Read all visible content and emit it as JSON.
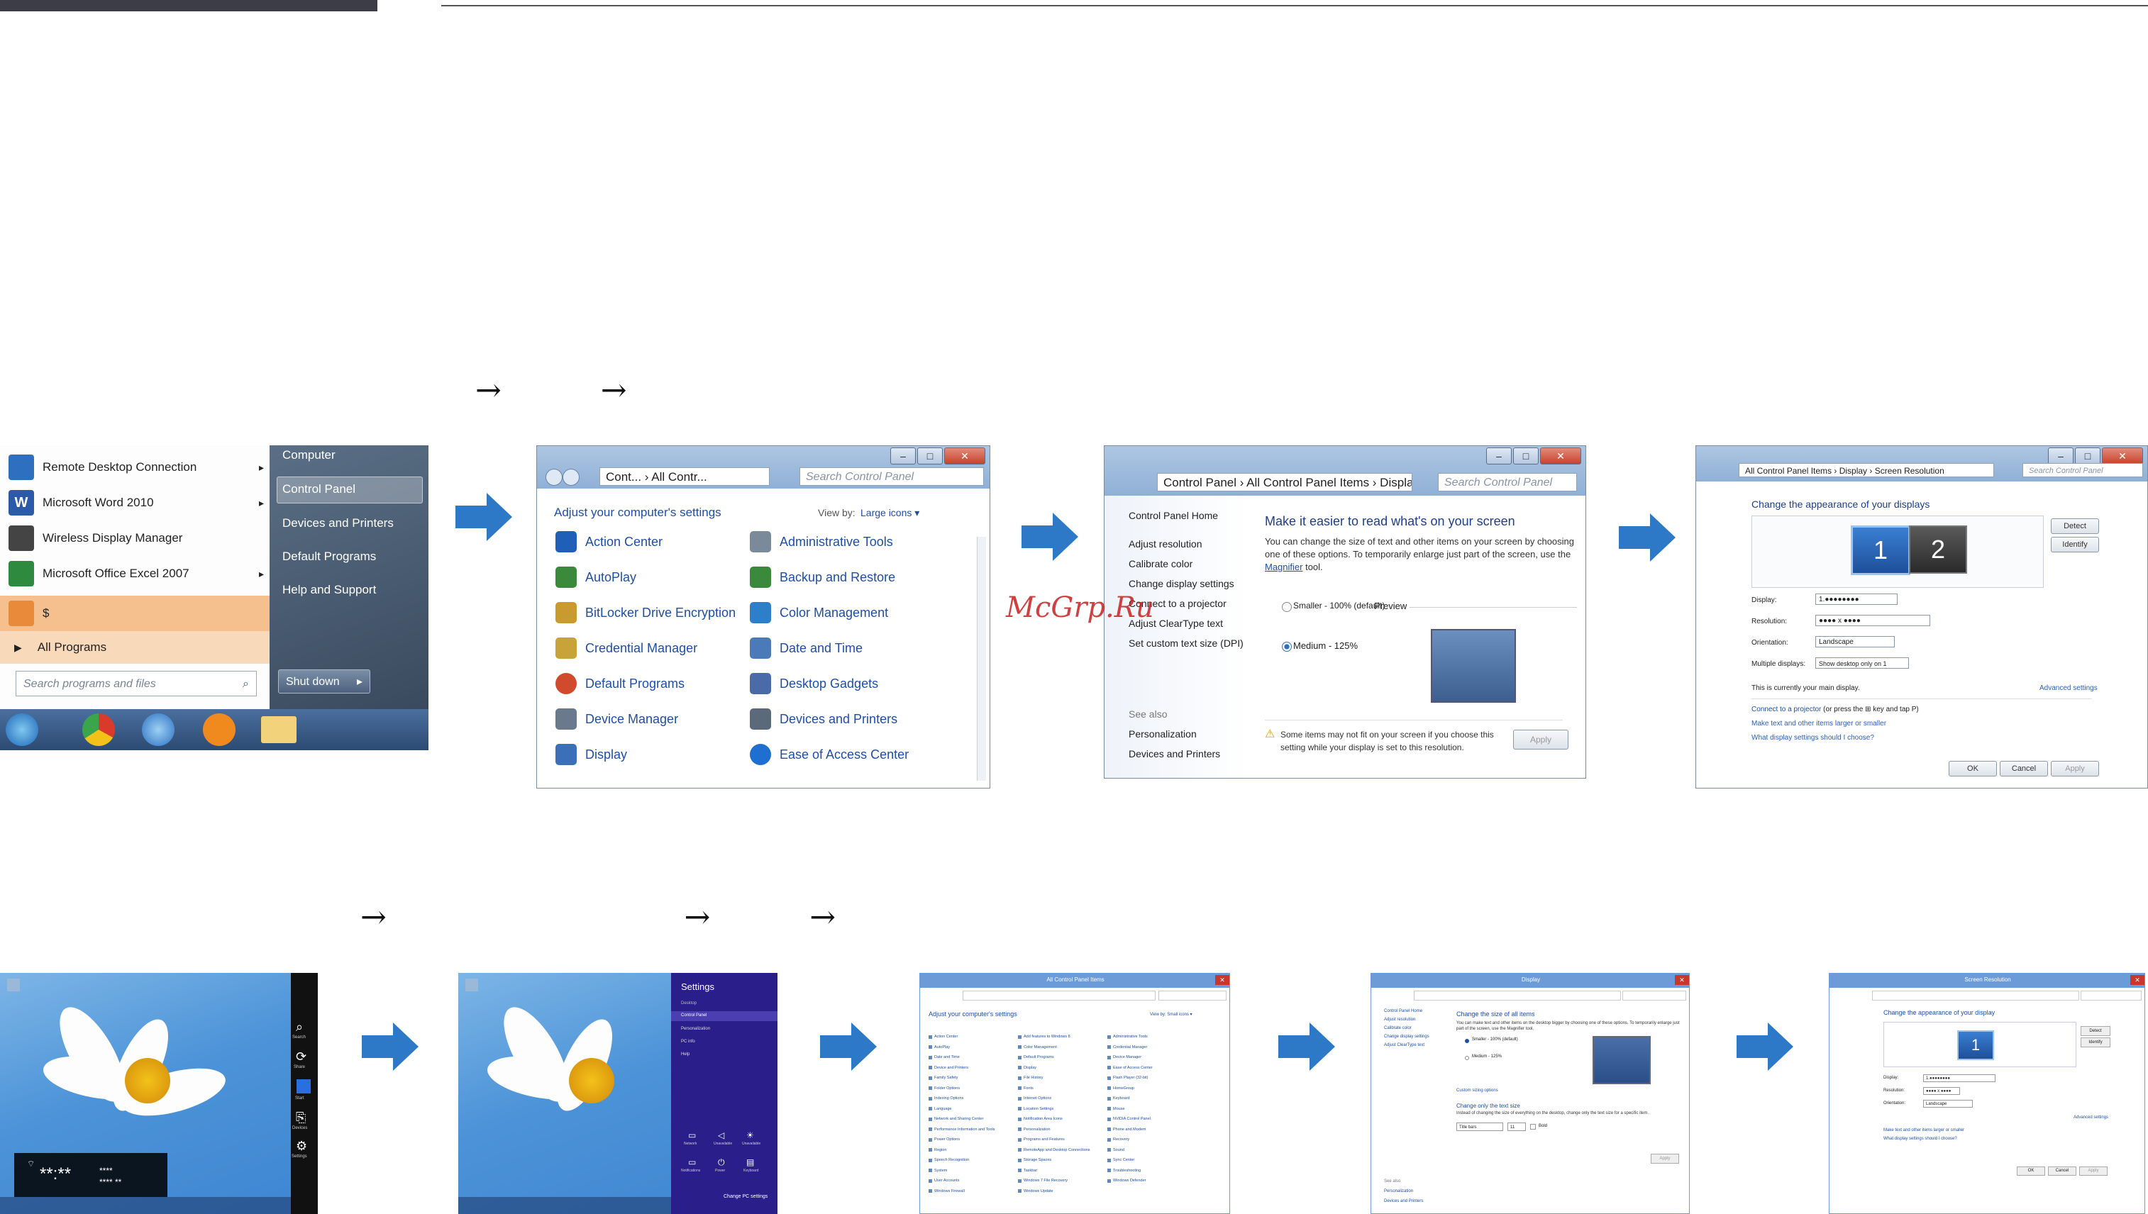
{
  "header": {
    "arrow_row1": "→          →",
    "arrow_row2": "→                              →          →"
  },
  "watermark": "McGrp.Ru",
  "start_menu": {
    "items": [
      {
        "label": "Remote Desktop Connection",
        "arrow": "▸"
      },
      {
        "label": "Microsoft Word 2010",
        "arrow": "▸"
      },
      {
        "label": "Wireless Display Manager",
        "arrow": ""
      },
      {
        "label": "Microsoft Office Excel 2007",
        "arrow": "▸"
      },
      {
        "label": "$",
        "arrow": ""
      }
    ],
    "all_programs": "All Programs",
    "search_placeholder": "Search programs and files",
    "right": [
      "Computer",
      "Control Panel",
      "Devices and Printers",
      "Default Programs",
      "Help and Support"
    ],
    "shutdown": "Shut down"
  },
  "control_panel": {
    "address": "Cont... › All Contr...",
    "search": "Search Control Panel",
    "heading": "Adjust your computer's settings",
    "view_by_label": "View by:",
    "view_by_value": "Large icons ▾",
    "items_left": [
      "Action Center",
      "AutoPlay",
      "BitLocker Drive Encryption",
      "Credential Manager",
      "Default Programs",
      "Device Manager",
      "Display"
    ],
    "items_right": [
      "Administrative Tools",
      "Backup and Restore",
      "Color Management",
      "Date and Time",
      "Desktop Gadgets",
      "Devices and Printers",
      "Ease of Access Center"
    ],
    "icon_colors_left": [
      "#1f5fb8",
      "#3b8a3b",
      "#c99a2e",
      "#c7a33a",
      "#d04a2c",
      "#6a7a8c",
      "#3b6fb8"
    ],
    "icon_colors_right": [
      "#7a8a9a",
      "#3b8a3b",
      "#2e7fc9",
      "#4a7ab8",
      "#4a6aa8",
      "#5a6a7a",
      "#1f6fd0"
    ]
  },
  "display": {
    "address": "Control Panel › All Control Panel Items › Display",
    "search": "Search Control Panel",
    "sidebar": [
      "Control Panel Home",
      "Adjust resolution",
      "Calibrate color",
      "Change display settings",
      "Connect to a projector",
      "Adjust ClearType text",
      "Set custom text size (DPI)"
    ],
    "see_also": "See also",
    "see_also_items": [
      "Personalization",
      "Devices and Printers"
    ],
    "heading": "Make it easier to read what's on your screen",
    "desc": "You can change the size of text and other items on your screen by choosing one of these options. To temporarily enlarge just part of the screen, use the",
    "desc_link": "Magnifier",
    "desc_end": "tool.",
    "option_small": "Smaller - 100% (default)",
    "preview": "Preview",
    "option_medium": "Medium - 125%",
    "warning": "Some items may not fit on your screen if you choose this setting while your display is set to this resolution.",
    "apply": "Apply"
  },
  "resolution": {
    "address": "All Control Panel Items › Display › Screen Resolution",
    "search": "Search Control Panel",
    "heading": "Change the appearance of your displays",
    "detect": "Detect",
    "identify": "Identify",
    "mon1": "1",
    "mon2": "2",
    "rows": [
      {
        "label": "Display:",
        "value": "1.●●●●●●●●"
      },
      {
        "label": "Resolution:",
        "value": "●●●● x ●●●●"
      },
      {
        "label": "Orientation:",
        "value": "Landscape"
      },
      {
        "label": "Multiple displays:",
        "value": "Show desktop only on 1"
      }
    ],
    "main_display": "This is currently your main display.",
    "advanced": "Advanced settings",
    "connect_a": "Connect to a projector",
    "connect_b": "(or press the ⊞ key and tap P)",
    "text_link": "Make text and other items larger or smaller",
    "which_link": "What display settings should I choose?",
    "ok": "OK",
    "cancel": "Cancel",
    "apply": "Apply"
  },
  "win8_desktop": {
    "charms": [
      "Search",
      "Share",
      "Start",
      "Devices",
      "Settings"
    ],
    "clock_a": "**:**",
    "clock_b": "****",
    "clock_c": "**** **"
  },
  "win8_settings": {
    "title": "Settings",
    "items": [
      "Desktop",
      "Control Panel",
      "Personalization",
      "PC info",
      "Help"
    ],
    "tiles": [
      "Network",
      "Unavailable",
      "Unavailable",
      "Notifications",
      "Power",
      "Keyboard"
    ],
    "change_pc": "Change PC settings"
  },
  "win8_cp": {
    "title": "All Control Panel Items",
    "heading": "Adjust your computer's settings",
    "view_by": "View by:  Small icons ▾",
    "col1": [
      "Action Center",
      "AutoPlay",
      "Date and Time",
      "Device and Printers",
      "Family Safety",
      "Folder Options",
      "Indexing Options",
      "Language",
      "Network and Sharing Center",
      "Performance Information and Tools",
      "Power Options",
      "Region",
      "Speech Recognition",
      "System",
      "User Accounts",
      "Windows Firewall"
    ],
    "col2": [
      "Add features to Windows 8",
      "Color Management",
      "Default Programs",
      "Display",
      "File History",
      "Fonts",
      "Internet Options",
      "Location Settings",
      "Notification Area Icons",
      "Personalization",
      "Programs and Features",
      "RemoteApp and Desktop Connections",
      "Storage Spaces",
      "Taskbar",
      "Windows 7 File Recovery",
      "Windows Update"
    ],
    "col3": [
      "Administrative Tools",
      "Credential Manager",
      "Device Manager",
      "Ease of Access Center",
      "Flash Player (32-bit)",
      "HomeGroup",
      "Keyboard",
      "Mouse",
      "NVIDIA Control Panel",
      "Phone and Modem",
      "Recovery",
      "Sound",
      "Sync Center",
      "Troubleshooting",
      "Windows Defender"
    ]
  },
  "win8_display": {
    "title": "Display",
    "sidebar": [
      "Control Panel Home",
      "Adjust resolution",
      "Calibrate color",
      "Change display settings",
      "Adjust ClearType text"
    ],
    "heading": "Change the size of all items",
    "desc": "You can make text and other items on the desktop bigger by choosing one of these options. To temporarily enlarge just part of the screen, use the Magnifier tool.",
    "opt1": "Smaller - 100% (default)",
    "opt2": "Medium - 125%",
    "custom": "Custom sizing options",
    "text_heading": "Change only the text size",
    "text_desc": "Instead of changing the size of everything on the desktop, change only the text size for a specific item.",
    "title_bars": "Title bars",
    "size": "11",
    "bold": "Bold",
    "apply": "Apply",
    "see_also": "See also",
    "see_also_items": [
      "Personalization",
      "Devices and Printers"
    ]
  },
  "win8_res": {
    "title": "Screen Resolution",
    "heading": "Change the appearance of your display",
    "detect": "Detect",
    "identify": "Identify",
    "mon": "1",
    "rows": [
      {
        "label": "Display:",
        "value": "1.●●●●●●●●"
      },
      {
        "label": "Resolution:",
        "value": "●●●● x ●●●●"
      },
      {
        "label": "Orientation:",
        "value": "Landscape"
      }
    ],
    "advanced": "Advanced settings",
    "link1": "Make text and other items larger or smaller",
    "link2": "What display settings should I choose?",
    "ok": "OK",
    "cancel": "Cancel",
    "apply": "Apply"
  }
}
